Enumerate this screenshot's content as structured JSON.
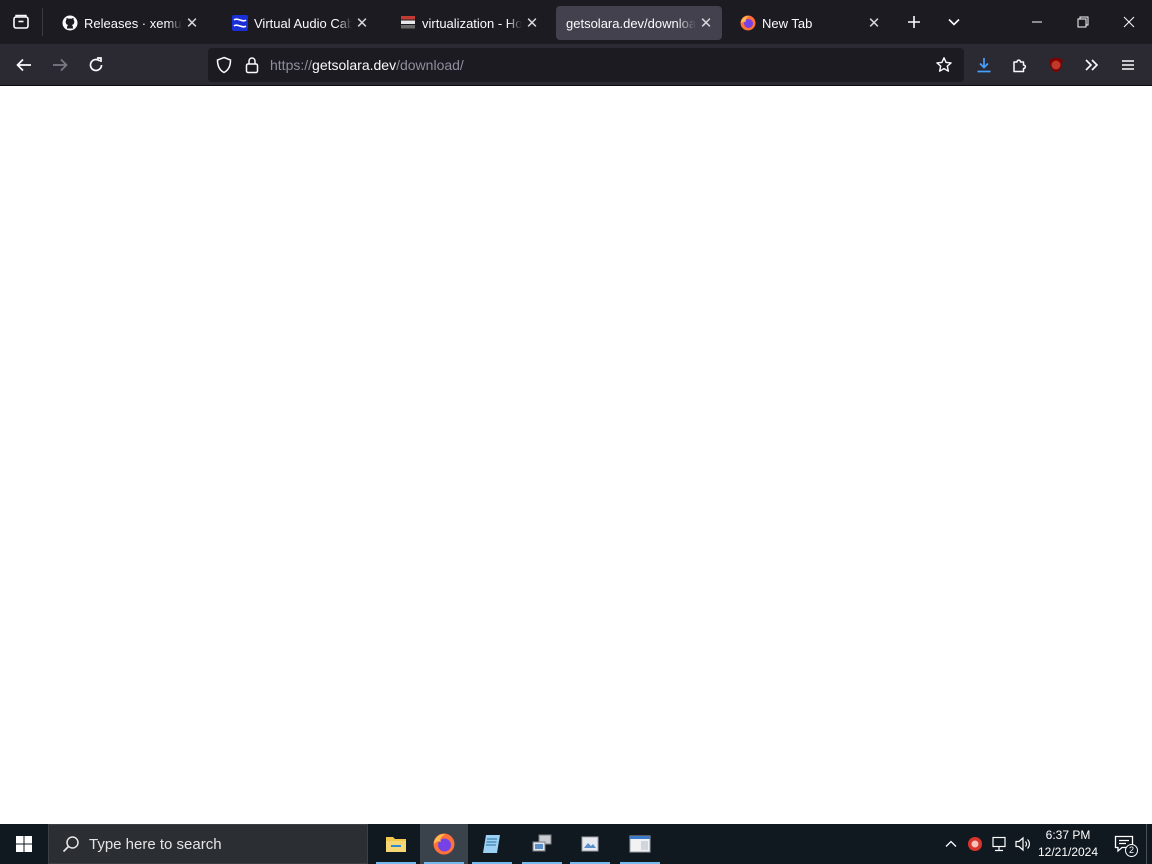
{
  "browser": {
    "tabs": [
      {
        "title": "Releases · xemu-project",
        "icon": "github-icon",
        "active": false
      },
      {
        "title": "Virtual Audio Cable - ",
        "icon": "vac-icon",
        "active": false
      },
      {
        "title": "virtualization - How to",
        "icon": "stackexchange-icon",
        "active": false
      },
      {
        "title": "getsolara.dev/download/",
        "icon": "blank-icon",
        "active": true
      },
      {
        "title": "New Tab",
        "icon": "firefox-icon",
        "active": false
      }
    ],
    "url": {
      "scheme": "https://",
      "host": "getsolara.dev",
      "path": "/download/"
    },
    "colors": {
      "tabstrip": "#1c1b22",
      "navbar": "#2b2a33",
      "active_tab": "#42414d",
      "download_accent": "#45a1ff",
      "ublock_red": "#800000"
    }
  },
  "taskbar": {
    "search_placeholder": "Type here to search",
    "apps": [
      "file-explorer-icon",
      "firefox-icon",
      "notepad-icon",
      "network-app-icon",
      "gallery-app-icon",
      "window-app-icon"
    ],
    "clock": {
      "time": "6:37 PM",
      "date": "12/21/2024"
    },
    "notification_count": "2"
  }
}
